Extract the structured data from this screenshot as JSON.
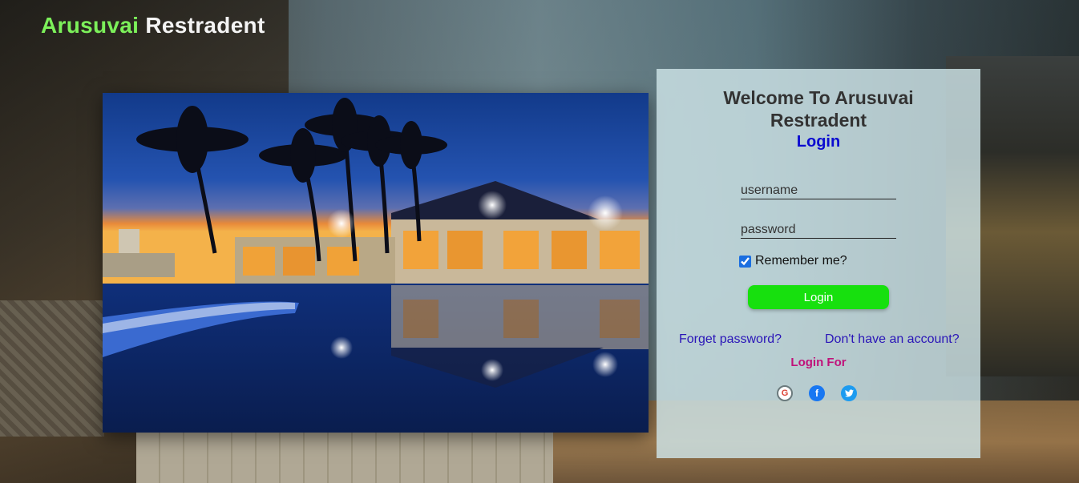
{
  "brand": {
    "first": "Arusuvai",
    "second": "Restradent"
  },
  "card": {
    "title": "Welcome To Arusuvai Restradent",
    "subtitle": "Login",
    "username_placeholder": "username",
    "password_placeholder": "password",
    "remember_label": "Remember me?",
    "remember_checked": true,
    "login_button": "Login",
    "forgot_link": "Forget password?",
    "signup_link": "Don't have an account?",
    "login_for": "Login For",
    "socials": [
      {
        "name": "google",
        "glyph": "G"
      },
      {
        "name": "facebook",
        "glyph": "f"
      },
      {
        "name": "twitter",
        "glyph": "🐦"
      }
    ]
  },
  "colors": {
    "brand_accent": "#7cf05a",
    "login_button": "#17e00e",
    "subtitle": "#0b0bd0",
    "links": "#2a15b8",
    "login_for": "#c0127a"
  }
}
